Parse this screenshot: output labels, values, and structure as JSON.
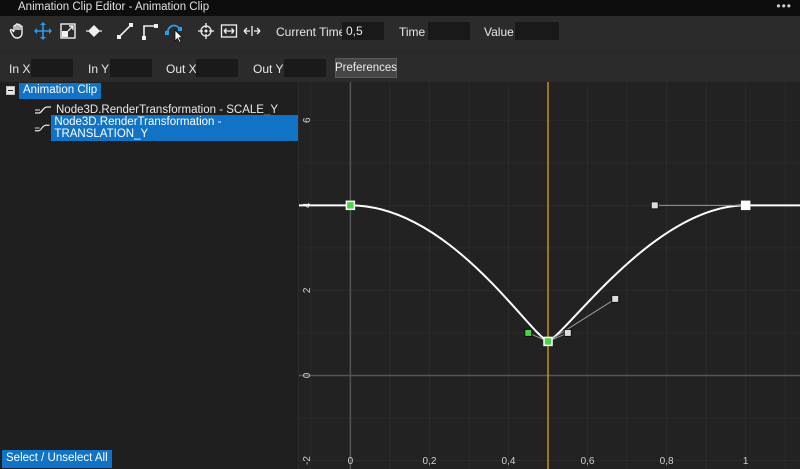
{
  "window": {
    "title": "Animation Clip Editor - Animation Clip",
    "more_label": "•••"
  },
  "toolbar": {
    "tools": [
      {
        "icon": "hand-icon",
        "name": "pan-tool",
        "active": false
      },
      {
        "icon": "move-icon",
        "name": "move-tool",
        "active": true
      },
      {
        "icon": "scale-icon",
        "name": "scale-tool",
        "active": false
      },
      {
        "icon": "keyframe-icon",
        "name": "add-keyframe-tool",
        "active": false
      },
      {
        "icon": "linear-tangent-icon",
        "name": "linear-tangent-tool",
        "active": false
      },
      {
        "icon": "step-tangent-icon",
        "name": "step-tangent-tool",
        "active": false
      },
      {
        "icon": "smooth-tangent-icon",
        "name": "smooth-tangent-tool",
        "active": true
      },
      {
        "icon": "focus-icon",
        "name": "focus-tool",
        "active": false
      },
      {
        "icon": "fit-all-icon",
        "name": "fit-all-tool",
        "active": false
      },
      {
        "icon": "fit-horizontal-icon",
        "name": "fit-horizontal-tool",
        "active": false
      }
    ],
    "current_time_label": "Current Time",
    "current_time_value": "0,5",
    "time_label": "Time",
    "time_value": "",
    "value_label": "Value",
    "value_value": ""
  },
  "tangent_row": {
    "in_x_label": "In X",
    "in_y_label": "In Y",
    "out_x_label": "Out X",
    "out_y_label": "Out Y",
    "preferences_label": "Preferences"
  },
  "tree": {
    "root_label": "Animation Clip",
    "tracks": [
      {
        "label": "Node3D.RenderTransformation - SCALE_Y",
        "selected": false
      },
      {
        "label": "Node3D.RenderTransformation - TRANSLATION_Y",
        "selected": true
      }
    ]
  },
  "footer": {
    "select_all_label": "Select / Unselect All"
  },
  "graph": {
    "x_ticks": [
      "0",
      "0,2",
      "0,4",
      "0,6",
      "0,8",
      "1"
    ],
    "x_tick_values": [
      0,
      0.2,
      0.4,
      0.6,
      0.8,
      1.0
    ],
    "y_ticks": [
      "-2",
      "0",
      "2",
      "4",
      "6"
    ],
    "y_tick_values": [
      -2,
      0,
      2,
      4,
      6
    ],
    "x_range": [
      -0.13,
      1.14
    ],
    "y_range": [
      -2.2,
      6.9
    ],
    "current_time": 0.5,
    "colors": {
      "background": "#222222",
      "grid": "#2b2b2b",
      "axis": "#555555",
      "curve": "#ffffff",
      "current_time": "#e0a020",
      "tangent": "#9a9a9a",
      "key_selected": "#4cd24c"
    },
    "keyframes": [
      {
        "t": 0.0,
        "v": 4.0,
        "selected": true
      },
      {
        "t": 0.5,
        "v": 0.8,
        "selected": true
      },
      {
        "t": 1.0,
        "v": 4.0,
        "selected": false
      }
    ],
    "tangent_handles": [
      {
        "t": 0.45,
        "v": 1.0,
        "selected": true,
        "from": 1
      },
      {
        "t": 0.55,
        "v": 1.0,
        "selected": false,
        "from": 1
      },
      {
        "t": 0.67,
        "v": 1.8,
        "selected": false,
        "from": 1
      },
      {
        "t": 0.77,
        "v": 4.0,
        "selected": false,
        "from": 2
      }
    ]
  }
}
